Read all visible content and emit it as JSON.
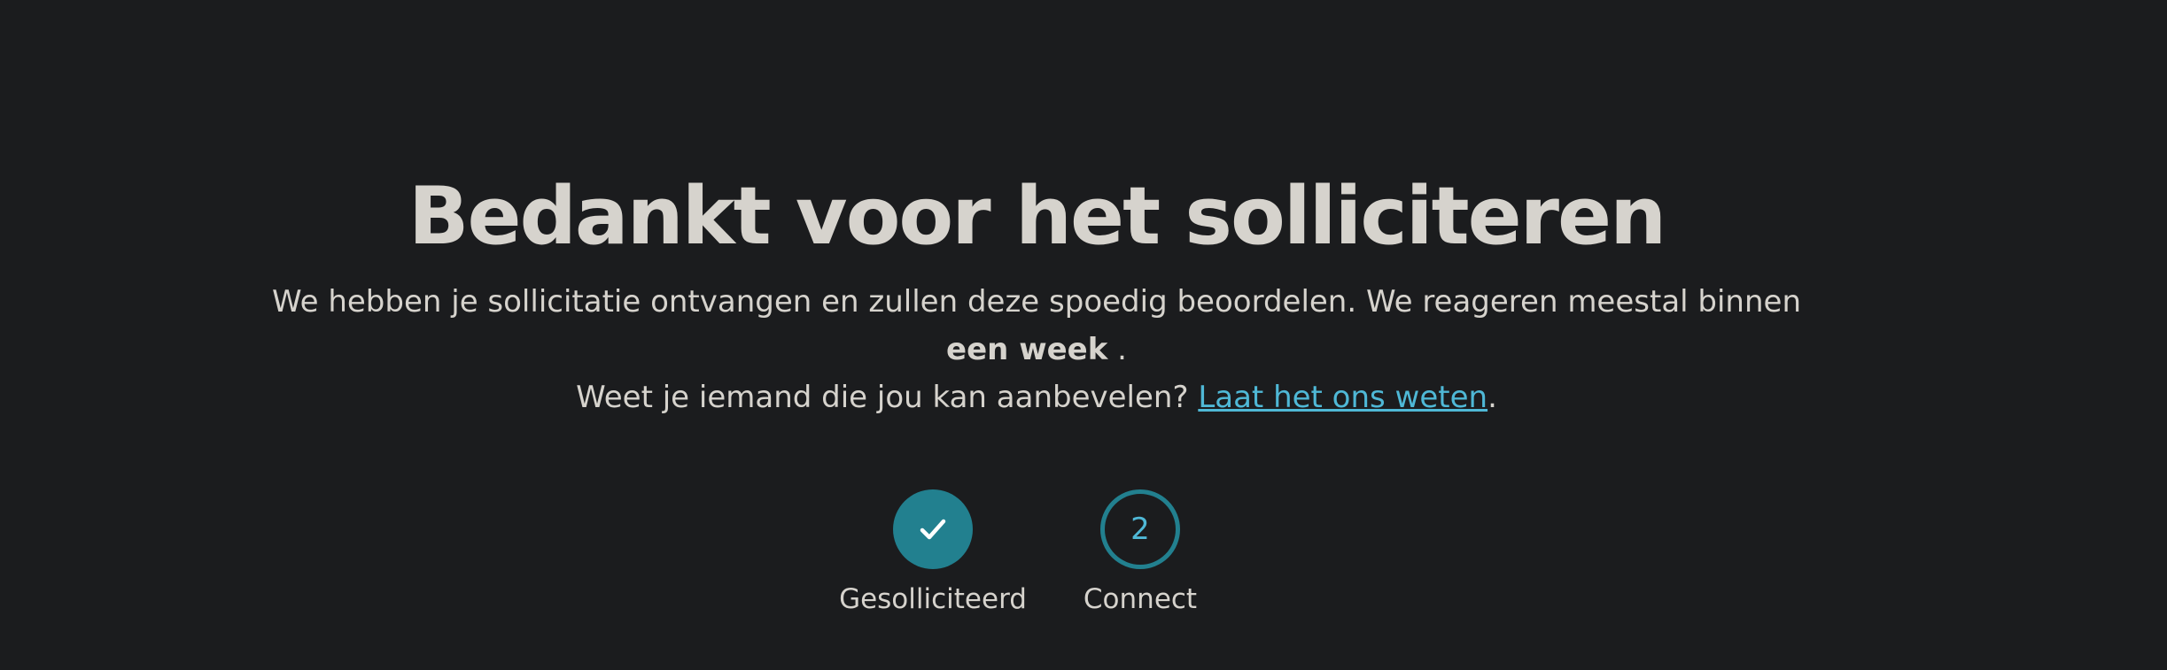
{
  "header": {
    "title": "Bedankt voor het solliciteren"
  },
  "message": {
    "line1_prefix": "We hebben je sollicitatie ontvangen en zullen deze spoedig beoordelen. We reageren meestal binnen ",
    "line1_bold": "een week",
    "line1_suffix": " .",
    "line2_prefix": "Weet je iemand die jou kan aanbevelen? ",
    "line2_link": "Laat het ons weten",
    "line2_suffix": "."
  },
  "steps": [
    {
      "label": "Gesolliciteerd",
      "state": "completed",
      "icon": "check-icon"
    },
    {
      "label": "Connect",
      "state": "pending",
      "number": "2"
    }
  ],
  "colors": {
    "background": "#1b1c1e",
    "text": "#d6d3cd",
    "accent": "#22808f",
    "link": "#4fb8d6"
  }
}
